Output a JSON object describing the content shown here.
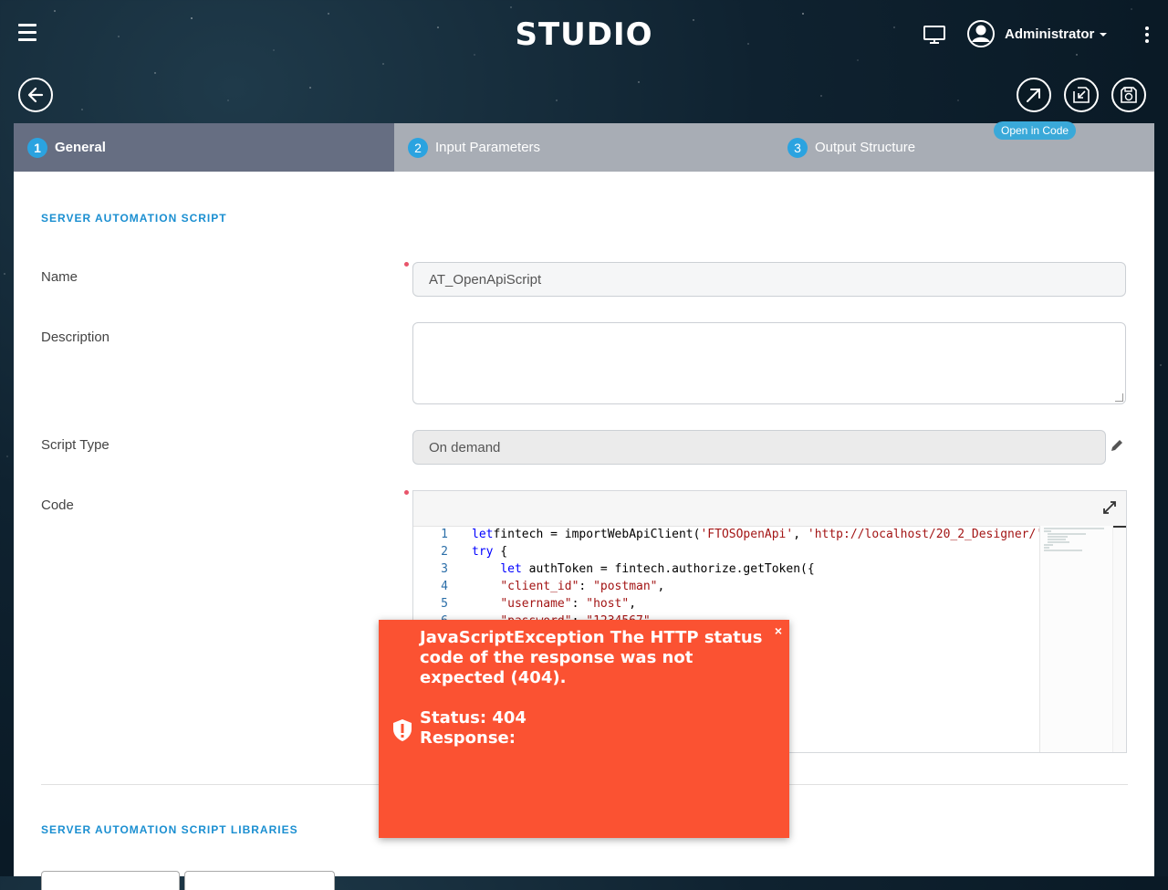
{
  "header": {
    "app_title": "STUDIO",
    "user_name": "Administrator",
    "tooltip": "Open in Code"
  },
  "tabs": [
    {
      "number": "1",
      "label": "General",
      "active": true
    },
    {
      "number": "2",
      "label": "Input Parameters",
      "active": false
    },
    {
      "number": "3",
      "label": "Output Structure",
      "active": false
    }
  ],
  "form": {
    "section_title": "SERVER AUTOMATION SCRIPT",
    "name_label": "Name",
    "name_value": "AT_OpenApiScript",
    "description_label": "Description",
    "description_value": "",
    "script_type_label": "Script Type",
    "script_type_value": "On demand",
    "code_label": "Code"
  },
  "code": {
    "lines": [
      {
        "n": "1",
        "parts": [
          [
            "kw",
            "let"
          ],
          [
            "",
            "fintech = importWebApiClient("
          ],
          [
            "str",
            "'FTOSOpenApi'"
          ],
          [
            "",
            ", "
          ],
          [
            "str",
            "'http://localhost/20_2_Designer/'"
          ]
        ]
      },
      {
        "n": "2",
        "parts": [
          [
            "kw",
            "try"
          ],
          [
            "",
            " {"
          ]
        ]
      },
      {
        "n": "3",
        "parts": [
          [
            "",
            "    "
          ],
          [
            "kw",
            "let"
          ],
          [
            "",
            " authToken = fintech.authorize.getToken({"
          ]
        ]
      },
      {
        "n": "4",
        "parts": [
          [
            "",
            "    "
          ],
          [
            "str",
            "\"client_id\""
          ],
          [
            "",
            ": "
          ],
          [
            "str",
            "\"postman\""
          ],
          [
            "",
            ","
          ]
        ]
      },
      {
        "n": "5",
        "parts": [
          [
            "",
            "    "
          ],
          [
            "str",
            "\"username\""
          ],
          [
            "",
            ": "
          ],
          [
            "str",
            "\"host\""
          ],
          [
            "",
            ","
          ]
        ]
      },
      {
        "n": "6",
        "parts": [
          [
            "",
            "    "
          ],
          [
            "str",
            "\"password\""
          ],
          [
            "",
            ": "
          ],
          [
            "str",
            "\"1234567\""
          ]
        ]
      }
    ]
  },
  "libraries": {
    "section_title": "SERVER AUTOMATION SCRIPT LIBRARIES"
  },
  "toast": {
    "message": "JavaScriptException The HTTP status code of the response was not expected (404).",
    "status": "Status: 404",
    "response": "Response:",
    "close": "×"
  },
  "colors": {
    "accent": "#2ba3e0",
    "tab_active": "#666e82",
    "tab_bar": "#a8adb5",
    "toast": "#fb5232",
    "section_title": "#1b8fd1",
    "required_dot": "#e8546a"
  }
}
